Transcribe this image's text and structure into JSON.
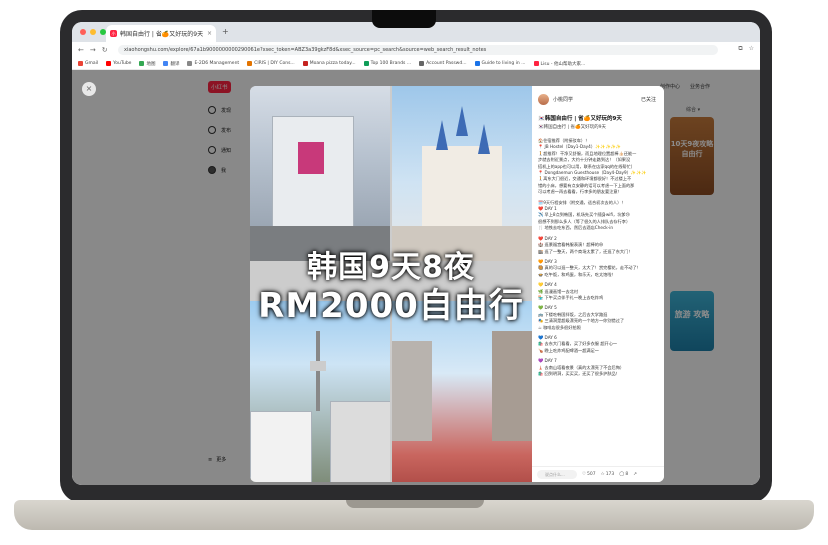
{
  "browser": {
    "tab_title": "韩国自由行 | 省🍊又好玩的9天",
    "url": "xiaohongshu.com/explore/67a1b9000000000290061e?xsec_token=ABZ3a39gkzF8d&xsec_source=pc_search&source=web_search_result_notes",
    "bookmarks": [
      "Gmail",
      "YouTube",
      "地图",
      "翻译",
      "E-2D6 Management",
      "CIRIS | DIY Cons...",
      "Moana pizza today...",
      "Top 100 Brands ...",
      "Account Passwd...",
      "Guide to living in ...",
      "Lisu - 他山帮助大家..."
    ]
  },
  "site": {
    "logo": "小红书",
    "nav": [
      "发现",
      "发布",
      "通知",
      "我"
    ],
    "more": "更多",
    "top_links": [
      "创作中心",
      "业务合作"
    ],
    "sort_label": "综合 ▾",
    "thumb1_text": "10天9夜攻略 自由行",
    "thumb2_text": "旅游 攻略"
  },
  "post": {
    "headline_line1": "韩国9天8夜",
    "headline_line2": "RM2000自由行",
    "author": "小桃同学",
    "follow_label": "已关注",
    "title": "🇰🇷韩国自由行 | 省🍊又好玩的9天",
    "subtitle": "🇰🇷韩国自由行 | 省🍊又好玩的9天",
    "lines": [
      "🏠住宿推荐（附接驳车）！",
      "📍 JB Hostel（Day1-Day4）✨✨✨✨✨",
      "🚶超推荐！干净又舒服，而且地理位置超棒👍🏻还能一",
      "步就去附近景点，大约十分钟走路到达！（如果没",
      "搭机上的app也可以用，联系在店家qq的在线帮忙）",
      "📍 Dongdaemun Guesthouse（Day4-Day9）✨✨✨",
      "🚶离东大门很近，交通和环境都很好！不过楼上不",
      "错的小床，想要有点安静的话可以考虑一下上面的那",
      "可以考虑～再去看看，行李多的朋友要注意！",
      "",
      "🗓️9天行程安排（附交通，适合初次去的人）！",
      "❤️ DAY 1",
      "✈️ 早上8点到韩国，机场先买个随身wifi，坑爹😢",
      "很想不到那么多人（等了很久的人排队去存行李）",
      "🍴 地铁去吃东西，然后去酒店Check-in",
      "",
      "❤️ DAY 2",
      "🏰 逛景福宫看韩服表演！超棒的😆",
      "🏬 逛了一整天，两个商场太累了，还逛了东大门！",
      "",
      "🧡 DAY 3",
      "🥘 真的可以逛一整天，太大了！赏完樱花，走不动了！",
      "🍲 吃午饭，和鸡蛋，和乐天，吃太饱啦！",
      "",
      "💛 DAY 4",
      "🌿 逛漫画馆～去北村",
      "🏪 下午买点伴手礼～晚上去吃炸鸡",
      "",
      "💚 DAY 5",
      "🚌 下楼吃韩国拌饭，之后去大学路逛",
      "🎭 三清洞是超级漂亮的一个地方～你别错过了",
      "☕ 咖啡店很多很好拍照",
      "",
      "💙 DAY 6",
      "🛍️ 去东大门看看，买了好多衣服 超开心～",
      "🍗 晚上吃炸鸡配啤酒～超满足～",
      "",
      "💜 DAY 7",
      "🗼 去南山塔看夜景（真的太漂亮了不会后悔）",
      "🛍️ 回到明洞，买买买，还买了很多护肤品！"
    ],
    "comment_placeholder": "说点什么...",
    "likes": "507",
    "collects": "173",
    "comments": "8"
  }
}
